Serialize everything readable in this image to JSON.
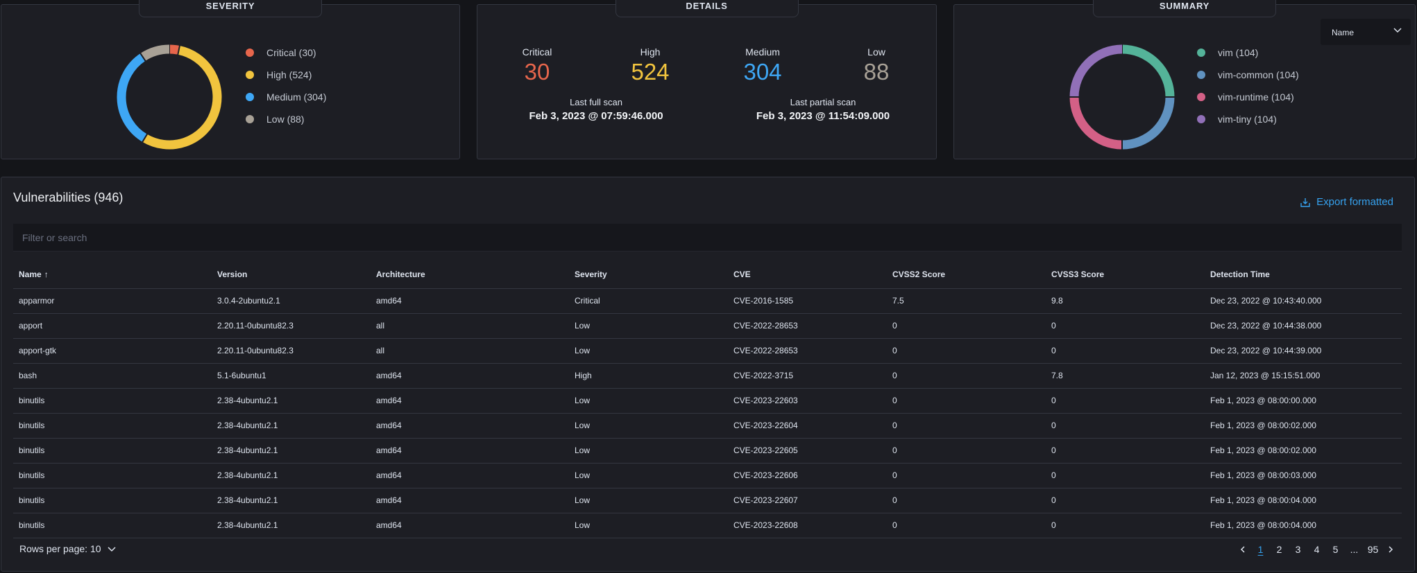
{
  "severity_panel": {
    "title": "SEVERITY",
    "legend": [
      {
        "label": "Critical (30)",
        "color": "#e7664c",
        "value": 30
      },
      {
        "label": "High (524)",
        "color": "#f1c43e",
        "value": 524
      },
      {
        "label": "Medium (304)",
        "color": "#3ea7f5",
        "value": 304
      },
      {
        "label": "Low (88)",
        "color": "#a8a196",
        "value": 88
      }
    ]
  },
  "details_panel": {
    "title": "DETAILS",
    "stats": [
      {
        "label": "Critical",
        "value": "30",
        "color": "#e7664c"
      },
      {
        "label": "High",
        "value": "524",
        "color": "#f1c43e"
      },
      {
        "label": "Medium",
        "value": "304",
        "color": "#3ea7f5"
      },
      {
        "label": "Low",
        "value": "88",
        "color": "#a8a196"
      }
    ],
    "last_full_scan_label": "Last full scan",
    "last_full_scan_value": "Feb 3, 2023 @ 07:59:46.000",
    "last_partial_scan_label": "Last partial scan",
    "last_partial_scan_value": "Feb 3, 2023 @ 11:54:09.000"
  },
  "summary_panel": {
    "title": "SUMMARY",
    "select_value": "Name",
    "legend": [
      {
        "label": "vim (104)",
        "color": "#54b399",
        "value": 104
      },
      {
        "label": "vim-common (104)",
        "color": "#6092c0",
        "value": 104
      },
      {
        "label": "vim-runtime (104)",
        "color": "#d36086",
        "value": 104
      },
      {
        "label": "vim-tiny (104)",
        "color": "#9170b8",
        "value": 104
      }
    ]
  },
  "vulnerabilities": {
    "title": "Vulnerabilities (946)",
    "export_label": "Export formatted",
    "filter_placeholder": "Filter or search",
    "columns": [
      "Name",
      "Version",
      "Architecture",
      "Severity",
      "CVE",
      "CVSS2 Score",
      "CVSS3 Score",
      "Detection Time"
    ],
    "sort_icon": "arrow-up-icon",
    "rows": [
      [
        "apparmor",
        "3.0.4-2ubuntu2.1",
        "amd64",
        "Critical",
        "CVE-2016-1585",
        "7.5",
        "9.8",
        "Dec 23, 2022 @ 10:43:40.000"
      ],
      [
        "apport",
        "2.20.11-0ubuntu82.3",
        "all",
        "Low",
        "CVE-2022-28653",
        "0",
        "0",
        "Dec 23, 2022 @ 10:44:38.000"
      ],
      [
        "apport-gtk",
        "2.20.11-0ubuntu82.3",
        "all",
        "Low",
        "CVE-2022-28653",
        "0",
        "0",
        "Dec 23, 2022 @ 10:44:39.000"
      ],
      [
        "bash",
        "5.1-6ubuntu1",
        "amd64",
        "High",
        "CVE-2022-3715",
        "0",
        "7.8",
        "Jan 12, 2023 @ 15:15:51.000"
      ],
      [
        "binutils",
        "2.38-4ubuntu2.1",
        "amd64",
        "Low",
        "CVE-2023-22603",
        "0",
        "0",
        "Feb 1, 2023 @ 08:00:00.000"
      ],
      [
        "binutils",
        "2.38-4ubuntu2.1",
        "amd64",
        "Low",
        "CVE-2023-22604",
        "0",
        "0",
        "Feb 1, 2023 @ 08:00:02.000"
      ],
      [
        "binutils",
        "2.38-4ubuntu2.1",
        "amd64",
        "Low",
        "CVE-2023-22605",
        "0",
        "0",
        "Feb 1, 2023 @ 08:00:02.000"
      ],
      [
        "binutils",
        "2.38-4ubuntu2.1",
        "amd64",
        "Low",
        "CVE-2023-22606",
        "0",
        "0",
        "Feb 1, 2023 @ 08:00:03.000"
      ],
      [
        "binutils",
        "2.38-4ubuntu2.1",
        "amd64",
        "Low",
        "CVE-2023-22607",
        "0",
        "0",
        "Feb 1, 2023 @ 08:00:04.000"
      ],
      [
        "binutils",
        "2.38-4ubuntu2.1",
        "amd64",
        "Low",
        "CVE-2023-22608",
        "0",
        "0",
        "Feb 1, 2023 @ 08:00:04.000"
      ]
    ],
    "rows_per_page_label": "Rows per page: 10",
    "pages": [
      "1",
      "2",
      "3",
      "4",
      "5",
      "...",
      "95"
    ],
    "active_page": "1"
  }
}
